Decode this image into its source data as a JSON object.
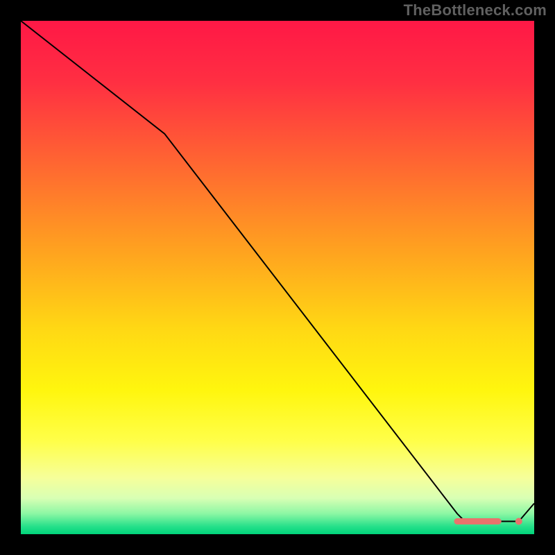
{
  "watermark": "TheBottleneck.com",
  "chart_data": {
    "type": "line",
    "title": "",
    "xlabel": "",
    "ylabel": "",
    "xlim": [
      0,
      100
    ],
    "ylim": [
      0,
      100
    ],
    "grid": false,
    "legend": false,
    "series": [
      {
        "name": "curve",
        "x": [
          0,
          28,
          85,
          86,
          87,
          88,
          89,
          90,
          91,
          92,
          93,
          97,
          100
        ],
        "y": [
          100,
          78,
          4,
          3,
          2.6,
          2.5,
          2.5,
          2.5,
          2.5,
          2.5,
          2.5,
          2.5,
          6
        ]
      }
    ],
    "markers": [
      {
        "name": "optimal-start",
        "kind": "pill",
        "x0": 85,
        "x1": 93,
        "y": 2.5
      },
      {
        "name": "optimal-end-dot",
        "kind": "dot",
        "x": 97,
        "y": 2.5
      }
    ],
    "gradient_stops": [
      {
        "offset": 0.0,
        "color": "#ff1846"
      },
      {
        "offset": 0.12,
        "color": "#ff2f42"
      },
      {
        "offset": 0.3,
        "color": "#ff6e2f"
      },
      {
        "offset": 0.45,
        "color": "#ffa31f"
      },
      {
        "offset": 0.6,
        "color": "#ffd814"
      },
      {
        "offset": 0.72,
        "color": "#fff60e"
      },
      {
        "offset": 0.82,
        "color": "#ffff4a"
      },
      {
        "offset": 0.89,
        "color": "#f6ff9a"
      },
      {
        "offset": 0.93,
        "color": "#d8ffb4"
      },
      {
        "offset": 0.96,
        "color": "#8cf7a4"
      },
      {
        "offset": 0.985,
        "color": "#26e08a"
      },
      {
        "offset": 1.0,
        "color": "#00d47a"
      }
    ],
    "marker_color": "#e9736c",
    "line_color": "#000000"
  }
}
